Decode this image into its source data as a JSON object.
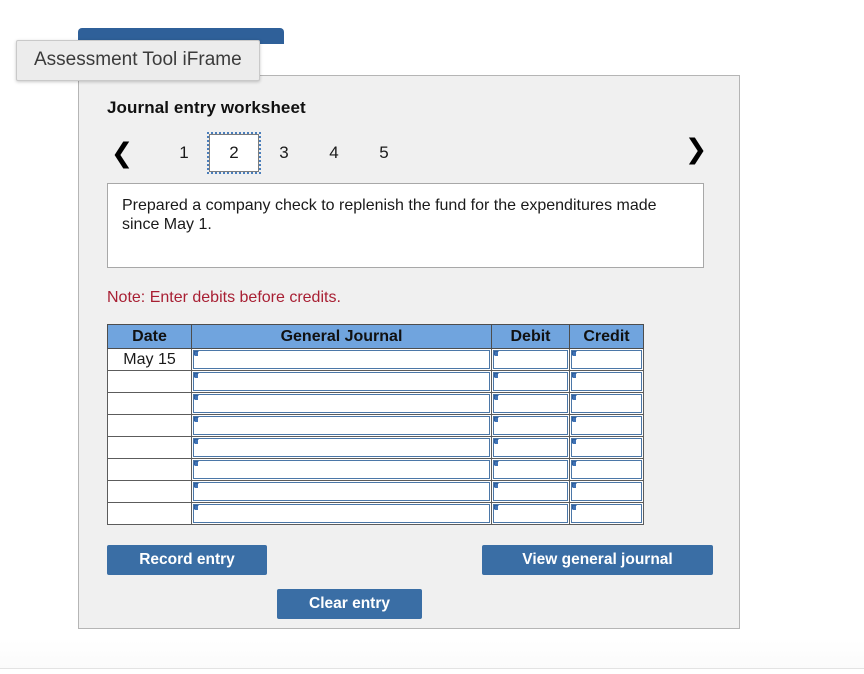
{
  "tooltip": {
    "label": "Assessment Tool iFrame"
  },
  "worksheet": {
    "title": "Journal entry worksheet",
    "pager": {
      "prev_icon": "chevron-left-icon",
      "next_icon": "chevron-right-icon",
      "prev_glyph": "❮",
      "next_glyph": "❯",
      "tabs": [
        "1",
        "2",
        "3",
        "4",
        "5"
      ],
      "active_tab": "2"
    },
    "transaction": {
      "text": "Prepared a company check to replenish the fund for the expenditures made since May 1."
    },
    "note": "Note: Enter debits before credits.",
    "table": {
      "headers": [
        "Date",
        "General Journal",
        "Debit",
        "Credit"
      ],
      "rows": [
        {
          "date": "May 15",
          "general_journal": "",
          "debit": "",
          "credit": ""
        },
        {
          "date": "",
          "general_journal": "",
          "debit": "",
          "credit": ""
        },
        {
          "date": "",
          "general_journal": "",
          "debit": "",
          "credit": ""
        },
        {
          "date": "",
          "general_journal": "",
          "debit": "",
          "credit": ""
        },
        {
          "date": "",
          "general_journal": "",
          "debit": "",
          "credit": ""
        },
        {
          "date": "",
          "general_journal": "",
          "debit": "",
          "credit": ""
        },
        {
          "date": "",
          "general_journal": "",
          "debit": "",
          "credit": ""
        },
        {
          "date": "",
          "general_journal": "",
          "debit": "",
          "credit": ""
        }
      ]
    },
    "buttons": {
      "record": "Record entry",
      "clear": "Clear entry",
      "view": "View general journal"
    }
  },
  "colors": {
    "button_blue": "#3a6ea5",
    "table_header_blue": "#70a4de",
    "note_red": "#a81f33",
    "panel_gray": "#f0f0f0",
    "cell_border_blue": "#4b77a8"
  }
}
